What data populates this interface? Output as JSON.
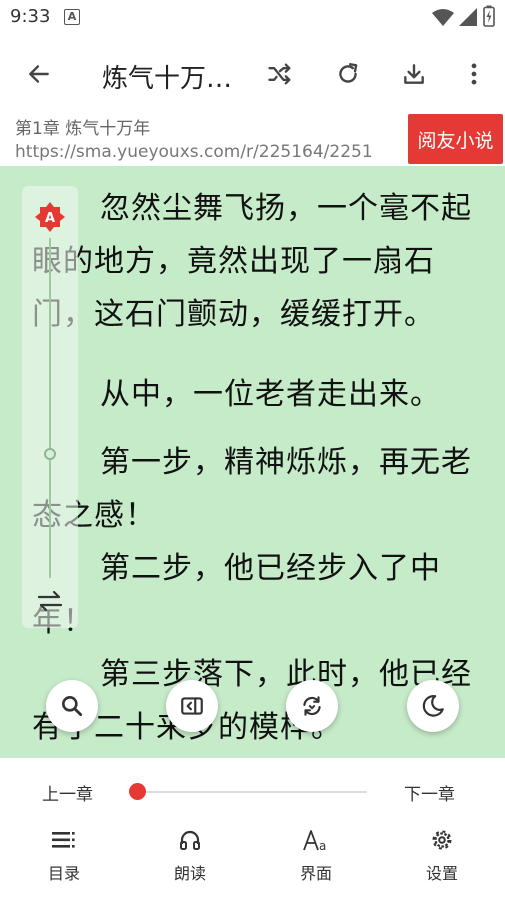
{
  "status_bar": {
    "time": "9:33",
    "notification_icon": "A"
  },
  "toolbar": {
    "title": "炼气十万…"
  },
  "subheader": {
    "chapter": "第1章 炼气十万年",
    "url": "https://sma.yueyouxs.com/r/225164/2251",
    "source_button": "阅友小说"
  },
  "content": {
    "paragraphs": [
      "忽然尘舞飞扬，一个毫不起眼的地方，竟然出现了一扇石门，这石门颤动，缓缓打开。",
      "从中，一位老者走出来。",
      "第一步，精神烁烁，再无老态之感！",
      "第二步，他已经步入了中年！",
      "第三步落下，此时，他已经有了二十来岁的模样。"
    ]
  },
  "side_panel": {
    "badge": "A"
  },
  "chapter_nav": {
    "prev": "上一章",
    "next": "下一章",
    "progress": 0.0
  },
  "bottom_tabs": [
    {
      "label": "目录",
      "icon": "list-icon"
    },
    {
      "label": "朗读",
      "icon": "headphones-icon"
    },
    {
      "label": "界面",
      "icon": "font-icon"
    },
    {
      "label": "设置",
      "icon": "gear-icon"
    }
  ]
}
